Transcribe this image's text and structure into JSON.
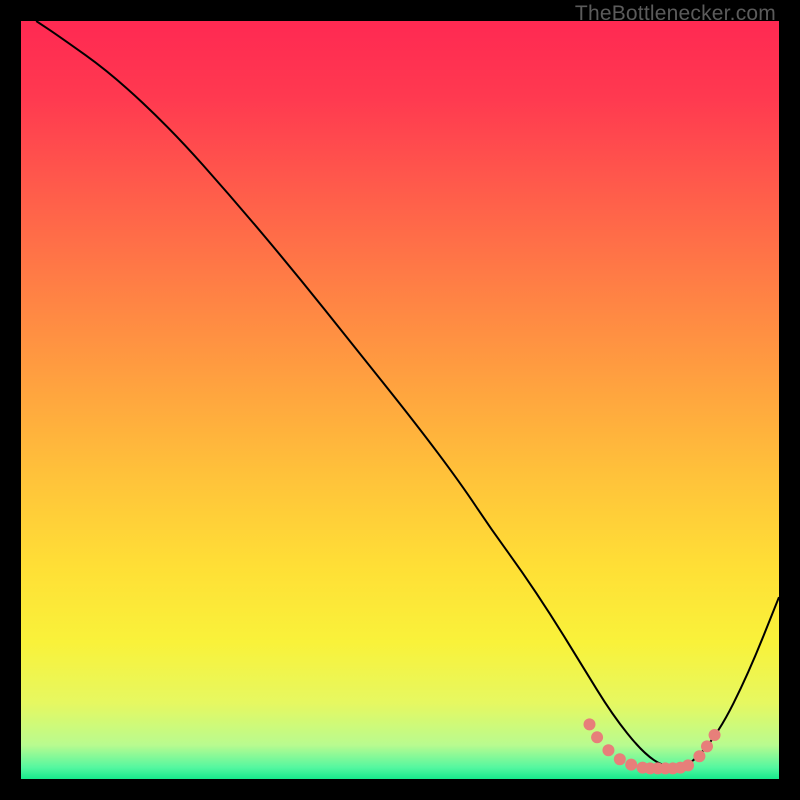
{
  "watermark": "TheBottlenecker.com",
  "chart_data": {
    "type": "line",
    "title": "",
    "xlabel": "",
    "ylabel": "",
    "xlim": [
      0,
      100
    ],
    "ylim": [
      0,
      100
    ],
    "grid": false,
    "background_gradient": {
      "stops": [
        {
          "offset": 0.0,
          "color": "#ff2952"
        },
        {
          "offset": 0.1,
          "color": "#ff3950"
        },
        {
          "offset": 0.22,
          "color": "#ff5b4b"
        },
        {
          "offset": 0.35,
          "color": "#ff7f45"
        },
        {
          "offset": 0.48,
          "color": "#ffa23f"
        },
        {
          "offset": 0.6,
          "color": "#ffc23a"
        },
        {
          "offset": 0.72,
          "color": "#ffdf36"
        },
        {
          "offset": 0.82,
          "color": "#f9f23a"
        },
        {
          "offset": 0.9,
          "color": "#e6f861"
        },
        {
          "offset": 0.955,
          "color": "#b9fb8f"
        },
        {
          "offset": 0.985,
          "color": "#54f7a0"
        },
        {
          "offset": 1.0,
          "color": "#16e98c"
        }
      ]
    },
    "series": [
      {
        "name": "bottleneck-curve",
        "type": "line",
        "color": "#000000",
        "width": 2,
        "x": [
          2,
          5,
          12,
          20,
          28,
          36,
          44,
          52,
          58,
          62,
          66,
          70,
          74,
          78,
          82,
          85,
          88,
          92,
          96,
          100
        ],
        "y": [
          100,
          98,
          93,
          85.5,
          76.5,
          67,
          57,
          47,
          39,
          33,
          27.5,
          21.5,
          15,
          8.5,
          3.5,
          1.5,
          1.5,
          6,
          14,
          24
        ]
      },
      {
        "name": "optimal-range-markers",
        "type": "scatter",
        "color": "#e77f7a",
        "radius": 6,
        "x": [
          75.0,
          76.0,
          77.5,
          79.0,
          80.5,
          82.0,
          83.0,
          84.0,
          85.0,
          86.0,
          87.0,
          88.0,
          89.5,
          90.5,
          91.5
        ],
        "y": [
          7.2,
          5.5,
          3.8,
          2.6,
          1.9,
          1.5,
          1.4,
          1.4,
          1.4,
          1.4,
          1.5,
          1.8,
          3.0,
          4.3,
          5.8
        ]
      }
    ]
  }
}
